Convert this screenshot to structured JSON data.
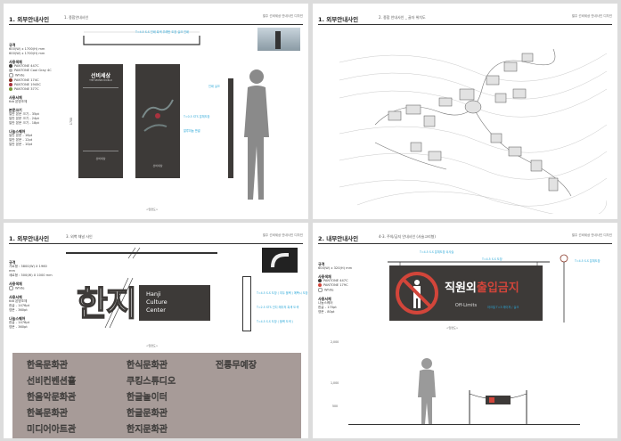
{
  "sheet1": {
    "section": "1. 외부안내사인",
    "subtitle": "1. 종합안내사인",
    "header_right": "벌주 선비세상 안내사인 디자인",
    "spec": {
      "size_title": "규격",
      "size_lines": [
        "600(W) x 1700(H) mm",
        "600(W) x 1700(H) mm"
      ],
      "color_title": "사용색채",
      "colors": [
        {
          "name": "PANTONE 447C",
          "hex": "#3d3a38"
        },
        {
          "name": "PANTONE Cool Gray 4C",
          "hex": "#b8b8b8"
        },
        {
          "name": "White",
          "hex": "#ffffff"
        },
        {
          "name": "PANTONE 174C",
          "hex": "#8a3a2a"
        },
        {
          "name": "PANTONE 1945C",
          "hex": "#a8323e"
        },
        {
          "name": "PANTONE 377C",
          "hex": "#7a9a3a"
        }
      ],
      "font_title": "사용서체",
      "font_name": "tbb 본명조체",
      "note_title": "본문크기",
      "notes": [
        "일반 본문 크기 - 35pt",
        "일반 본문 크기 - 24pt",
        "일반 본문 크기 - 18pt"
      ],
      "extra_title": "나눔스퀘어",
      "extra": [
        "일반 본문 - 16pt",
        "일반 본문 - 12pt",
        "일반 본문 - 10pt"
      ]
    },
    "sign_title": "선비세상",
    "sign_subtitle": "THE SEONBI WORLD",
    "sign_logo": "선비세상",
    "annotations": [
      "T=4.5 S.S 인쇄 흑색 우레탄 도장 실크 인쇄",
      "인쇄 실크",
      "알루미늄 판넬",
      "T=0.5 STS 분체도장",
      "인쇄 실크"
    ],
    "dims": [
      "600",
      "1700",
      "500",
      "1300"
    ],
    "footer": "<입면도>"
  },
  "sheet2": {
    "section": "1. 외부안내사인",
    "subtitle": "2. 종합 안내사인 _ 골자 위치도",
    "header_right": "벌주 선비세상 안내사인 디자인",
    "footer": ""
  },
  "sheet3": {
    "section": "1. 외부안내사인",
    "subtitle": "3. 외벽 채널 사인",
    "header_right": "벌주 선비세상 안내사인 디자인",
    "spec": {
      "size_title": "규격",
      "size_lines": [
        "가로형 : 3800(W) X 1960 mm",
        "세로형 : 300(W) X 1000 mm"
      ],
      "color_title": "사용색채",
      "colors": [
        {
          "name": "White",
          "hex": "#ffffff"
        }
      ],
      "font_title": "사용서체",
      "font_name": "tbb 본명조체",
      "font_sizes": [
        "한글 - 1476pt",
        "영문 - 360pt"
      ],
      "extra_title": "나눔스퀘어",
      "extra": [
        "한글 - 1476pt",
        "영문 - 360pt"
      ]
    },
    "hanji_ko": "한지",
    "hanji_en": [
      "Hanji",
      "Culture",
      "Center"
    ],
    "annotations": [
      "T=4.5 S.S 도장 ( 여두 블랙 ) 에폭시 도장",
      "T=2.5 STS 인디 레이저 흑색 도색",
      "T=4.5 S.S 도장 ( 블랙 도색 )"
    ],
    "dims": [
      "300",
      "1960",
      "3800",
      "2000",
      "1260"
    ],
    "footer": "<입면도>",
    "names_col1": [
      "한옥문화관",
      "선비컨벤션홀",
      "한음악문화관",
      "한복문화관",
      "미디어아트관"
    ],
    "names_col2": [
      "한식문화관",
      "쿠킹스튜디오",
      "한글놀이터",
      "한글문화관",
      "한지문화관"
    ],
    "names_col3": [
      "전통무예장"
    ]
  },
  "sheet4": {
    "section": "2. 내부안내사인",
    "subtitle": "4-3. 주의/금지 안내사인 (사슬고리형)",
    "header_right": "벌주 선비세상 안내사인 디자인",
    "spec": {
      "size_title": "규격",
      "size_lines": [
        "600(W) x 320(H) mm"
      ],
      "color_title": "사용색채",
      "colors": [
        {
          "name": "PANTONE 447C",
          "hex": "#3d3a38"
        },
        {
          "name": "PANTONE 179C",
          "hex": "#d2453a"
        },
        {
          "name": "White",
          "hex": "#ffffff"
        }
      ],
      "font_title": "사용서체",
      "font_name": "나눔스퀘어",
      "font_sizes": [
        "한글 - 170pt",
        "영문 - 80pt"
      ]
    },
    "sign_ko_a": "직원외",
    "sign_ko_b": "출입금지",
    "sign_en": "Off-Limits",
    "annotations": [
      "T=4.5 S.S 분체도장 쇠사슬",
      "T=4.5 S.S 도장",
      "아크릴 T=3 레이저 / 실크",
      "T=4.5 S.S 분체도장"
    ],
    "dims": [
      "600",
      "320",
      "2,000",
      "1,000",
      "500"
    ],
    "footer": "<입면도>"
  }
}
